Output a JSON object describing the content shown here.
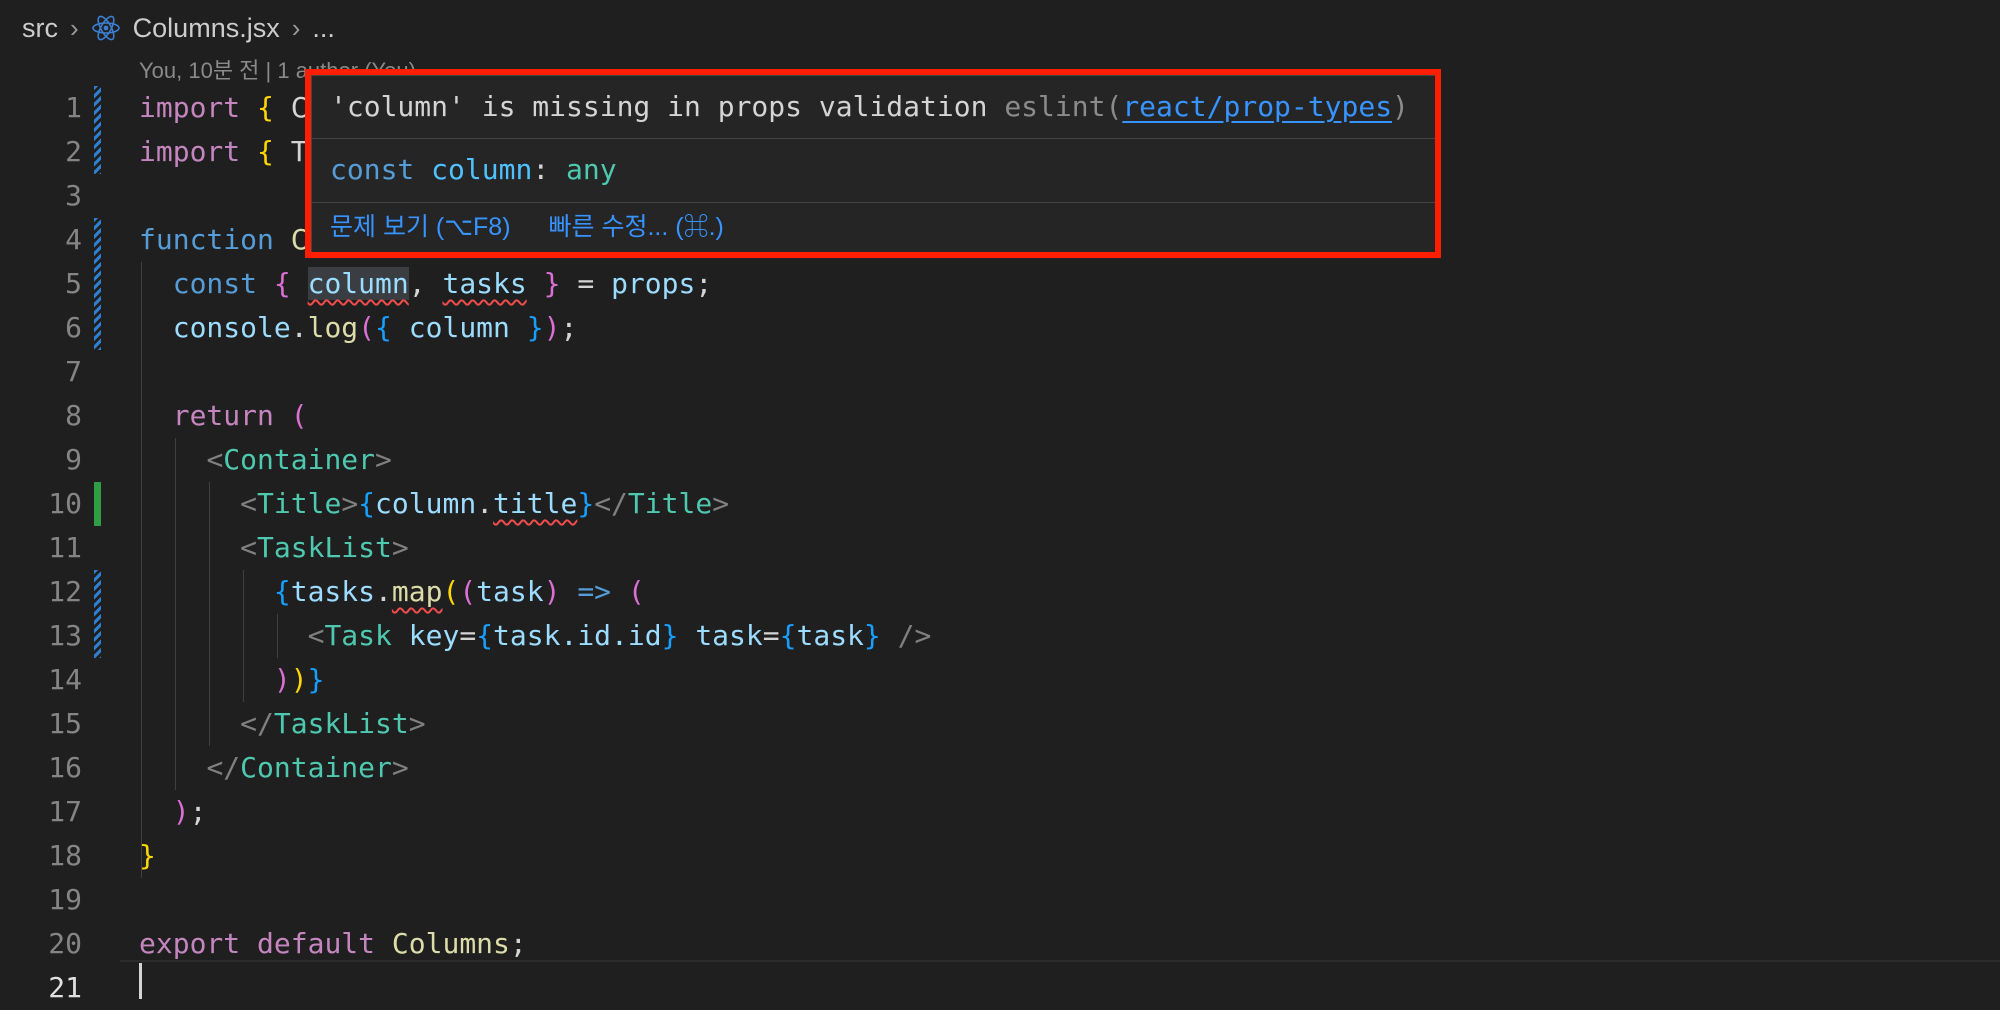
{
  "breadcrumb": {
    "folder": "src",
    "file": "Columns.jsx",
    "more": "..."
  },
  "blame": "You, 10분 전 | 1 author (You)",
  "line_numbers": [
    "1",
    "2",
    "3",
    "4",
    "5",
    "6",
    "7",
    "8",
    "9",
    "10",
    "11",
    "12",
    "13",
    "14",
    "15",
    "16",
    "17",
    "18",
    "19",
    "20",
    "21"
  ],
  "code": {
    "l1": {
      "kw": "import",
      "b": "{",
      "rest": "C"
    },
    "l2": {
      "kw": "import",
      "b": "{",
      "rest": "T"
    },
    "l4": {
      "kw": "function",
      "rest": "C"
    },
    "l5": {
      "kw": "const",
      "b1": "{",
      "v1": "column",
      "comma": ",",
      "v2": "tasks",
      "b2": "}",
      "eq": "=",
      "props": "props",
      "semi": ";"
    },
    "l6": {
      "obj": "console",
      "dot": ".",
      "fn": "log",
      "p1": "(",
      "b1": "{",
      "v": "column",
      "b2": "}",
      "p2": ")",
      "semi": ";"
    },
    "l8": {
      "kw": "return",
      "p": "("
    },
    "l9": {
      "lt": "<",
      "tag": "Container",
      "gt": ">"
    },
    "l10": {
      "lt": "<",
      "tag": "Title",
      "gt": ">",
      "b1": "{",
      "obj": "column",
      "dot": ".",
      "prop": "title",
      "b2": "}",
      "lt2": "</",
      "tag2": "Title",
      "gt2": ">"
    },
    "l11": {
      "lt": "<",
      "tag": "TaskList",
      "gt": ">"
    },
    "l12": {
      "b": "{",
      "obj": "tasks",
      "dot": ".",
      "fn": "map",
      "p1": "(",
      "p2": "(",
      "arg": "task",
      "p3": ")",
      "arrow": "=>",
      "p4": "("
    },
    "l13": {
      "lt": "<",
      "tag": "Task",
      "attr1": "key",
      "eq1": "=",
      "b1": "{",
      "val1": "task.id.id",
      "b2": "}",
      "attr2": "task",
      "eq2": "=",
      "b3": "{",
      "val2": "task",
      "b4": "}",
      "close": "/>"
    },
    "l14": {
      "p1": ")",
      "p2": ")",
      "b": "}"
    },
    "l15": {
      "lt": "</",
      "tag": "TaskList",
      "gt": ">"
    },
    "l16": {
      "lt": "</",
      "tag": "Container",
      "gt": ">"
    },
    "l17": {
      "p": ")",
      "semi": ";"
    },
    "l18": {
      "b": "}"
    },
    "l20": {
      "kw1": "export",
      "kw2": "default",
      "name": "Columns",
      "semi": ";"
    }
  },
  "hover": {
    "message": "'column' is missing in props validation",
    "source": "eslint(",
    "rule": "react/prop-types",
    "source_close": ")",
    "decl_kw": "const",
    "decl_name": "column",
    "decl_colon": ":",
    "decl_type": "any",
    "view_problem": "문제 보기 (⌥F8)",
    "quick_fix": "빠른 수정... (⌘.)"
  },
  "colors": {
    "highlight_box": "#ff1f00",
    "error_squiggle": "#f14c4c",
    "link": "#3794ff"
  },
  "icons": [
    "react-icon",
    "chevron-right-icon"
  ]
}
